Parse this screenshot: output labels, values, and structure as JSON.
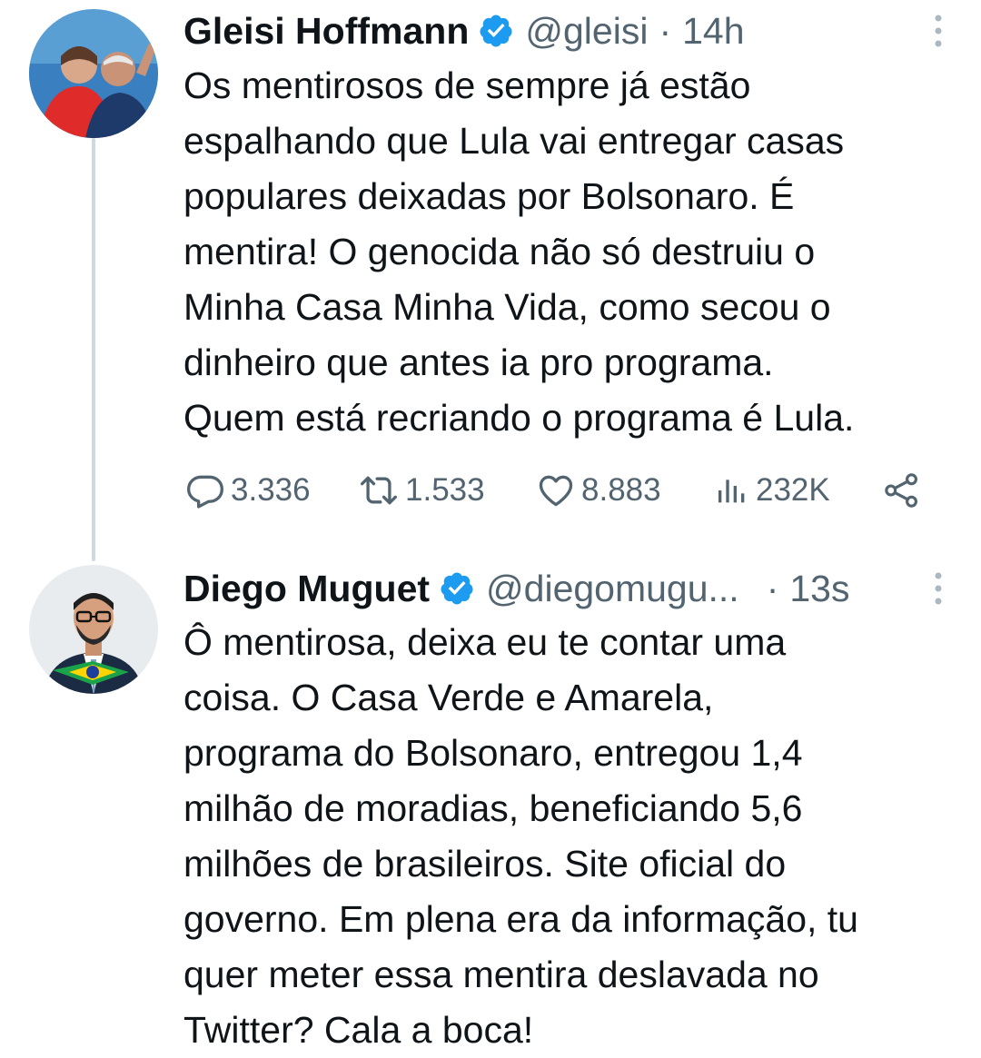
{
  "tweets": [
    {
      "author_name": "Gleisi Hoffmann",
      "handle": "@gleisi",
      "separator": "·",
      "time": "14h",
      "text": "Os mentirosos de sempre já estão\nespalhando que Lula vai entregar casas\npopulares deixadas por Bolsonaro. É\nmentira! O genocida não só destruiu o\nMinha Casa Minha Vida, como secou o\ndinheiro que antes ia pro programa.\nQuem está recriando o programa é Lula.",
      "stats": {
        "replies": "3.336",
        "retweets": "1.533",
        "likes": "8.883",
        "views": "232K"
      }
    },
    {
      "author_name": "Diego Muguet",
      "handle": "@diegomugu...",
      "separator": "·",
      "time": "13s",
      "text": "Ô mentirosa, deixa eu te contar uma\ncoisa. O Casa Verde e Amarela,\nprograma do Bolsonaro, entregou 1,4\nmilhão de moradias, beneficiando 5,6\nmilhões de brasileiros. Site oficial do\ngoverno. Em plena era da informação, tu\nquer meter essa mentira deslavada no\nTwitter? Cala a boca!"
    }
  ],
  "colors": {
    "verified": "#1d9bf0",
    "secondary_text": "#536471",
    "thread_line": "#cfd9de"
  }
}
